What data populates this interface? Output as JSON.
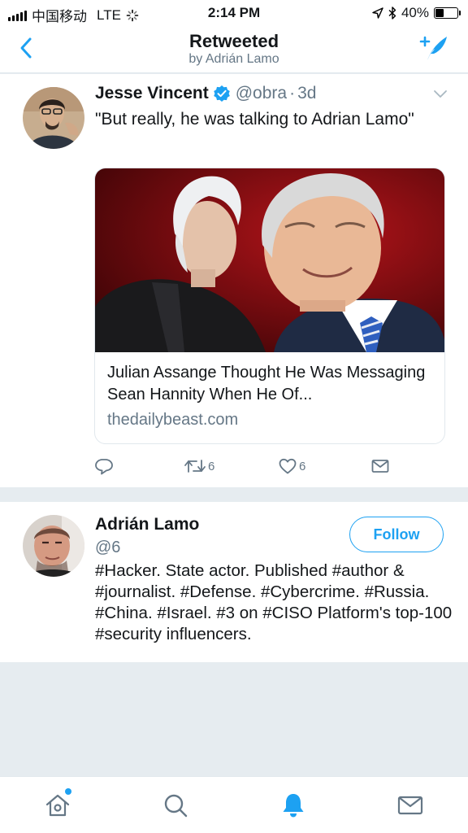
{
  "status_bar": {
    "carrier": "中国移动",
    "network": "LTE",
    "time": "2:14 PM",
    "battery": "40%",
    "battery_level": 0.4
  },
  "header": {
    "title": "Retweeted",
    "subtitle": "by Adrián Lamo",
    "back_icon": "chevron-left-icon",
    "compose_icon": "compose-tweet-icon"
  },
  "tweet": {
    "name": "Jesse Vincent",
    "handle": "@obra",
    "separator": "·",
    "time": "3d",
    "text": "\"But really, he was talking to Adrian Lamo\"",
    "card": {
      "title": "Julian Assange Thought He Was Messaging Sean Hannity When He Of...",
      "domain": "thedailybeast.com"
    },
    "actions": {
      "retweet_count": "6",
      "like_count": "6"
    }
  },
  "profile": {
    "name": "Adrián Lamo",
    "handle": "@6",
    "follow_label": "Follow",
    "bio": "#Hacker. State actor. Published #author & #journalist. #Defense. #Cybercrime. #Russia. #China. #Israel. #3 on #CISO Platform's top-100 #security influencers."
  },
  "colors": {
    "accent": "#1da1f2",
    "secondary_text": "#657786",
    "background": "#e6ecf0"
  }
}
